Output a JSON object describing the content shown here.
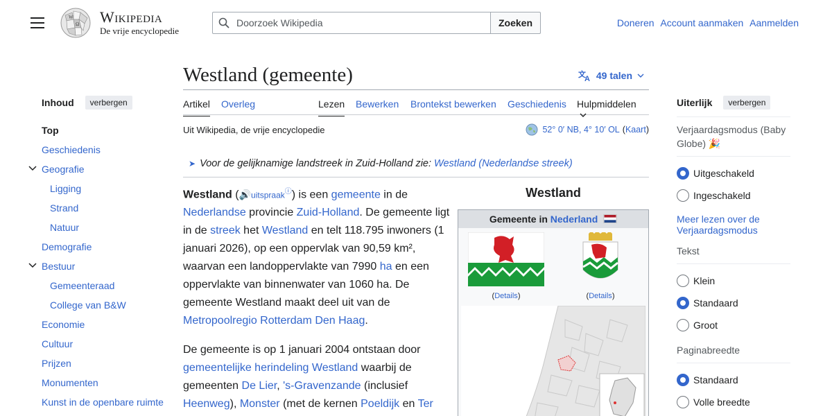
{
  "header": {
    "wordmark": "Wikipedia",
    "tagline": "De vrije encyclopedie",
    "search_placeholder": "Doorzoek Wikipedia",
    "search_button": "Zoeken",
    "links": [
      "Doneren",
      "Account aanmaken",
      "Aanmelden"
    ]
  },
  "toc": {
    "title": "Inhoud",
    "hide_label": "verbergen",
    "items": [
      {
        "label": "Top",
        "level": 0
      },
      {
        "label": "Geschiedenis",
        "level": 0
      },
      {
        "label": "Geografie",
        "level": 0
      },
      {
        "label": "Ligging",
        "level": 1
      },
      {
        "label": "Strand",
        "level": 1
      },
      {
        "label": "Natuur",
        "level": 1
      },
      {
        "label": "Demografie",
        "level": 0
      },
      {
        "label": "Bestuur",
        "level": 0
      },
      {
        "label": "Gemeenteraad",
        "level": 1
      },
      {
        "label": "College van B&W",
        "level": 1
      },
      {
        "label": "Economie",
        "level": 0
      },
      {
        "label": "Cultuur",
        "level": 0
      },
      {
        "label": "Prijzen",
        "level": 0
      },
      {
        "label": "Monumenten",
        "level": 0
      },
      {
        "label": "Kunst in de openbare ruimte",
        "level": 0
      }
    ]
  },
  "article": {
    "title": "Westland (gemeente)",
    "languages": "49 talen",
    "tabs_left": [
      "Artikel",
      "Overleg"
    ],
    "tabs_right": [
      "Lezen",
      "Bewerken",
      "Brontekst bewerken",
      "Geschiedenis",
      "Hulpmiddelen"
    ],
    "site_sub": "Uit Wikipedia, de vrije encyclopedie",
    "coords": "52° 0′ NB, 4° 10′ OL",
    "coords_link": "Kaart",
    "hatnote_text": "Voor de gelijknamige landstreek in Zuid-Holland zie: ",
    "hatnote_link": "Westland (Nederlandse streek)",
    "p1": {
      "bold": "Westland",
      "uitspraak": "uitspraak",
      "t1": ") is een ",
      "l1": "gemeente",
      "t2": " in de ",
      "l2": "Nederlandse",
      "t3": " provincie ",
      "l3": "Zuid-Holland",
      "t4": ". De gemeente ligt in de ",
      "l4": "streek",
      "t5": " het ",
      "l5": "Westland",
      "t6": " en telt 118.795 inwoners (1 januari 2026), op een oppervlak van 90,59 km², waarvan een landoppervlakte van 7990 ",
      "l6": "ha",
      "t7": " en een oppervlakte van binnenwater van 1060 ha. De gemeente Westland maakt deel uit van de ",
      "l7": "Metropoolregio Rotterdam Den Haag",
      "t8": "."
    },
    "p2": {
      "t1": "De gemeente is op 1 januari 2004 ontstaan door ",
      "l1": "gemeentelijke herindeling Westland",
      "t2": " waarbij de gemeenten ",
      "l2": "De Lier",
      "t3": ", ",
      "l3": "'s-Gravenzande",
      "t4": " (inclusief ",
      "l4": "Heenweg",
      "t5": "), ",
      "l5": "Monster",
      "t6": " (met de kernen ",
      "l6": "Poeldijk",
      "t7": " en ",
      "l7": "Ter"
    }
  },
  "infobox": {
    "title": "Westland",
    "head_text": "Gemeente in ",
    "head_link": "Nederland",
    "details": "Details"
  },
  "appearance": {
    "title": "Uiterlijk",
    "hide_label": "verbergen",
    "birthday_label": "Verjaardagsmodus (Baby Globe) 🎉",
    "birthday_options": [
      {
        "label": "Uitgeschakeld",
        "checked": true
      },
      {
        "label": "Ingeschakeld",
        "checked": false
      }
    ],
    "birthday_link": "Meer lezen over de Verjaardagsmodus",
    "text_label": "Tekst",
    "text_options": [
      {
        "label": "Klein",
        "checked": false
      },
      {
        "label": "Standaard",
        "checked": true
      },
      {
        "label": "Groot",
        "checked": false
      }
    ],
    "width_label": "Paginabreedte",
    "width_options": [
      {
        "label": "Standaard",
        "checked": true
      },
      {
        "label": "Volle breedte",
        "checked": false
      }
    ]
  },
  "colors": {
    "link": "#3366cc",
    "text": "#202122",
    "radio_checked": "#3366cc"
  }
}
